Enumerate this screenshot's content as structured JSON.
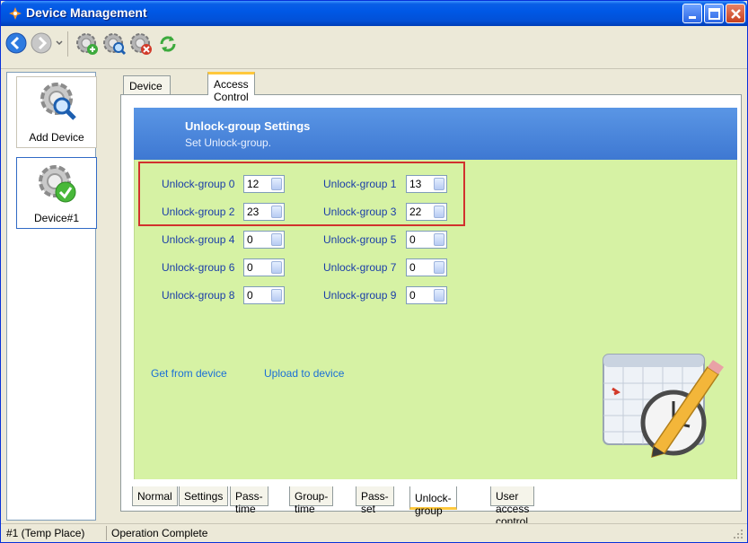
{
  "window": {
    "title": "Device Management"
  },
  "toolbar": {
    "icons": [
      "back-arrow-icon",
      "forward-arrow-icon",
      "device-add-icon",
      "device-search-icon",
      "device-delete-icon",
      "refresh-icon"
    ]
  },
  "devices": [
    {
      "label": "Add Device"
    },
    {
      "label": "Device#1"
    }
  ],
  "top_tabs": [
    {
      "label": "Device Control"
    },
    {
      "label": "Access Control"
    }
  ],
  "header": {
    "title": "Unlock-group Settings",
    "subtitle": "Set Unlock-group."
  },
  "groups": [
    {
      "label": "Unlock-group 0",
      "value": "12"
    },
    {
      "label": "Unlock-group 1",
      "value": "13"
    },
    {
      "label": "Unlock-group 2",
      "value": "23"
    },
    {
      "label": "Unlock-group 3",
      "value": "22"
    },
    {
      "label": "Unlock-group 4",
      "value": "0"
    },
    {
      "label": "Unlock-group 5",
      "value": "0"
    },
    {
      "label": "Unlock-group 6",
      "value": "0"
    },
    {
      "label": "Unlock-group 7",
      "value": "0"
    },
    {
      "label": "Unlock-group 8",
      "value": "0"
    },
    {
      "label": "Unlock-group 9",
      "value": "0"
    }
  ],
  "actions": {
    "get_label": "Get from device",
    "upload_label": "Upload to device"
  },
  "bottom_tabs": [
    {
      "label": "Normal"
    },
    {
      "label": "Settings"
    },
    {
      "label": "Pass-time"
    },
    {
      "label": "Group-time"
    },
    {
      "label": "Pass-set"
    },
    {
      "label": "Unlock-group"
    },
    {
      "label": "User access control"
    }
  ],
  "status": {
    "place": "#1 (Temp Place)",
    "message": "Operation Complete"
  }
}
